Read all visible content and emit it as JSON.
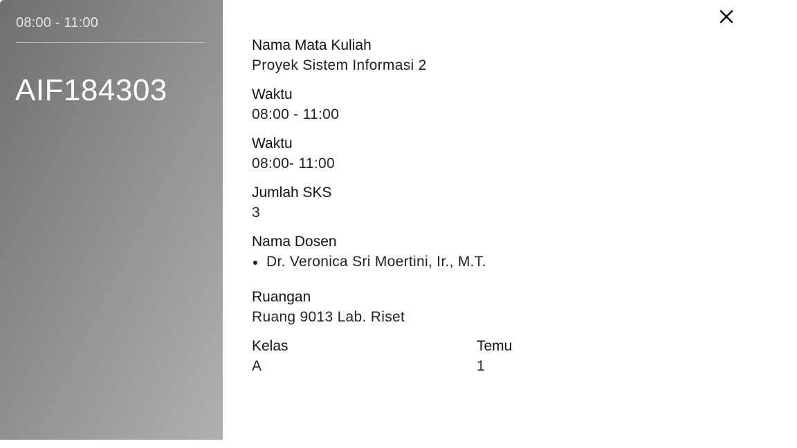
{
  "side_panel": {
    "time": "08:00 - 11:00",
    "course_code": "AIF184303"
  },
  "close_icon": "close-icon",
  "details": {
    "course_name": {
      "label": "Nama Mata Kuliah",
      "value": "Proyek Sistem Informasi 2"
    },
    "time_1": {
      "label": "Waktu",
      "value": "08:00 - 11:00"
    },
    "time_2": {
      "label": "Waktu",
      "value": "08:00- 11:00"
    },
    "credits": {
      "label": "Jumlah SKS",
      "value": "3"
    },
    "lecturer": {
      "label": "Nama Dosen",
      "items": [
        "Dr. Veronica Sri Moertini, Ir., M.T."
      ]
    },
    "room": {
      "label": "Ruangan",
      "value": "Ruang 9013 Lab. Riset"
    },
    "class": {
      "label": "Kelas",
      "value": "A"
    },
    "meeting": {
      "label": "Temu",
      "value": "1"
    }
  }
}
